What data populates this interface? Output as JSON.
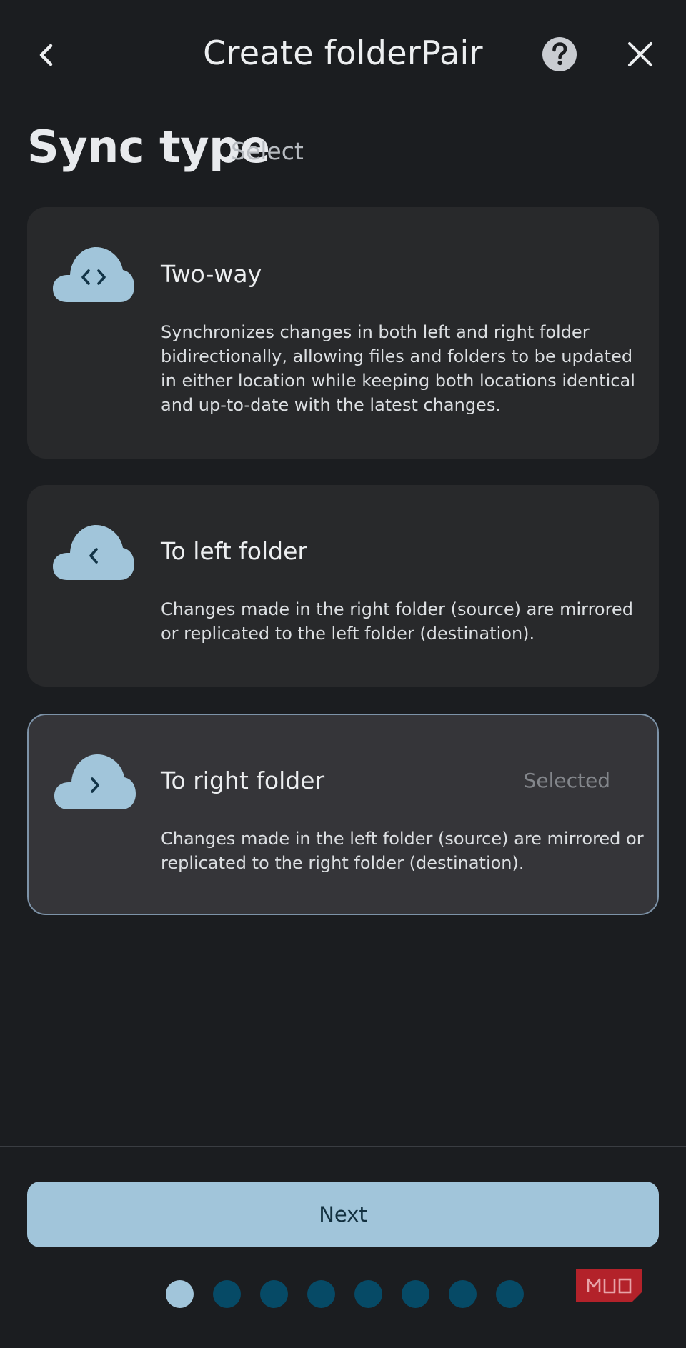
{
  "header": {
    "title": "Create folderPair",
    "back_icon": "chevron-left-icon",
    "help_icon": "help-circle-icon",
    "close_icon": "close-icon"
  },
  "section": {
    "title": "Sync type",
    "subtitle": "Select"
  },
  "options": [
    {
      "title": "Two-way",
      "description": "Synchronizes changes in both left and right folder bidirectionally, allowing files and folders to be updated in either location while keeping both locations identical and up-to-date with the latest changes.",
      "icon": "cloud-two-way-icon",
      "selected": false
    },
    {
      "title": "To left folder",
      "description": "Changes made in the right folder (source) are mirrored or replicated to the left folder (destination).",
      "icon": "cloud-left-icon",
      "selected": false
    },
    {
      "title": "To right folder",
      "description": "Changes made in the left folder (source) are mirrored or replicated to the right folder (destination).",
      "icon": "cloud-right-icon",
      "selected": true,
      "badge": "Selected"
    }
  ],
  "footer": {
    "next_label": "Next",
    "steps_total": 8,
    "current_step": 1
  },
  "watermark": {
    "text": "MUO"
  },
  "colors": {
    "background": "#1b1d20",
    "card": "#28292b",
    "card_selected": "#353539",
    "selected_border": "#7d93a8",
    "accent": "#a1c5da",
    "inactive_dot": "#064a66",
    "watermark_red": "#b3222a"
  }
}
